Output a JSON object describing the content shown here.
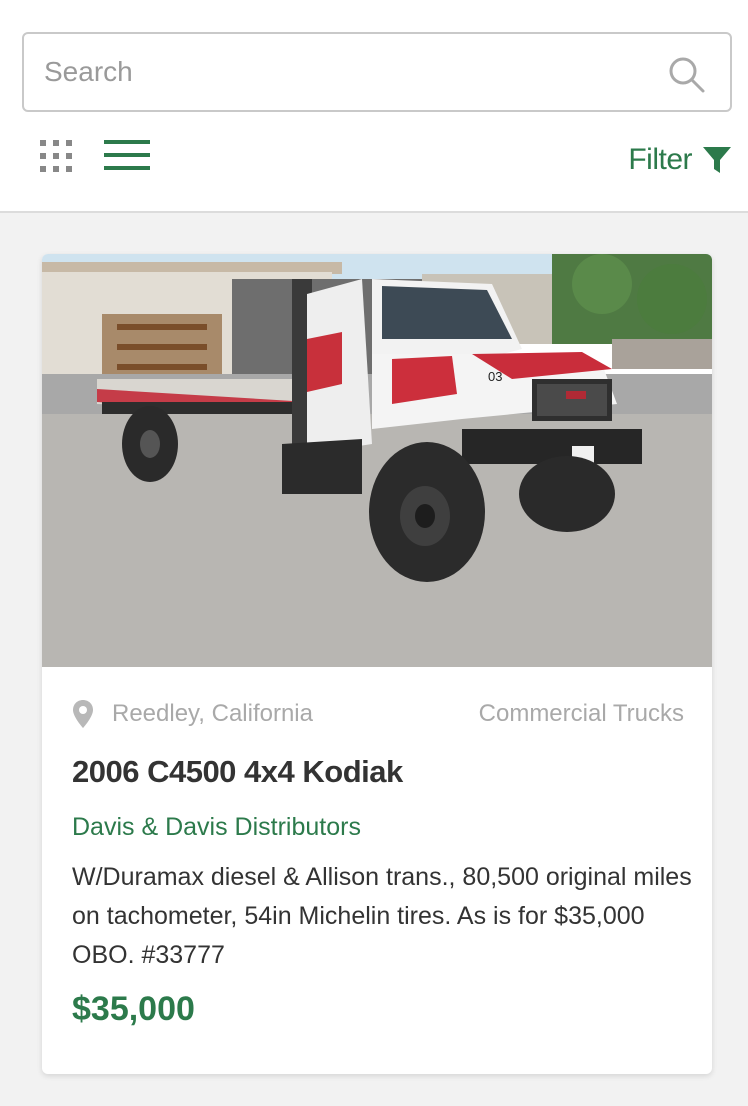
{
  "search": {
    "placeholder": "Search"
  },
  "view_toggle": {
    "grid_icon": "grid-icon",
    "list_icon": "list-icon",
    "active": "list"
  },
  "filter": {
    "label": "Filter",
    "icon": "funnel-icon"
  },
  "colors": {
    "accent": "#2c7a4b",
    "muted": "#a9a9a9",
    "text": "#333333",
    "background": "#f2f2f2"
  },
  "listing": {
    "image_alt": "photo",
    "location": "Reedley, California",
    "category": "Commercial Trucks",
    "title": "2006 C4500 4x4 Kodiak",
    "dealer": "Davis & Davis Distributors",
    "description": "W/Duramax diesel & Allison trans., 80,500 original miles on tachometer, 54in Michelin tires. As is for $35,000 OBO. #33777",
    "price": "$35,000",
    "truck_number": "03"
  }
}
